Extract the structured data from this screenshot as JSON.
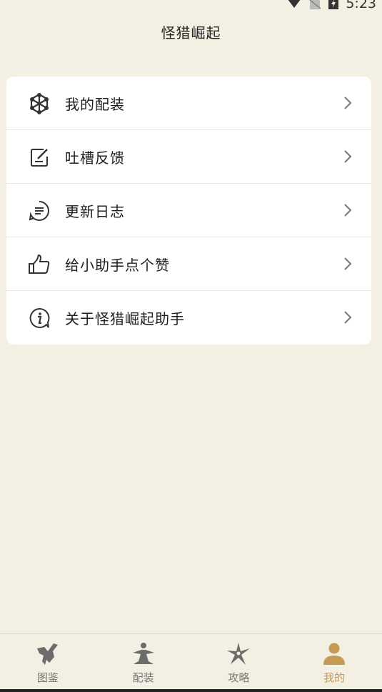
{
  "status_bar": {
    "time": "5:23",
    "icons": [
      "wifi-icon",
      "no-sim-icon",
      "battery-charging-icon"
    ]
  },
  "header": {
    "title": "怪猎崛起"
  },
  "menu": {
    "items": [
      {
        "label": "我的配装",
        "icon": "gear-molecule-icon"
      },
      {
        "label": "吐槽反馈",
        "icon": "feedback-note-icon"
      },
      {
        "label": "更新日志",
        "icon": "changelog-icon"
      },
      {
        "label": "给小助手点个赞",
        "icon": "thumbs-up-icon"
      },
      {
        "label": "关于怪猎崛起助手",
        "icon": "info-icon"
      }
    ]
  },
  "tabbar": {
    "active_color": "#c59a55",
    "inactive_color": "#777777",
    "tabs": [
      {
        "label": "图鉴",
        "icon": "wyvern-icon",
        "active": false
      },
      {
        "label": "配装",
        "icon": "hunter-icon",
        "active": false
      },
      {
        "label": "攻略",
        "icon": "shuriken-icon",
        "active": false
      },
      {
        "label": "我的",
        "icon": "person-icon",
        "active": true
      }
    ]
  }
}
